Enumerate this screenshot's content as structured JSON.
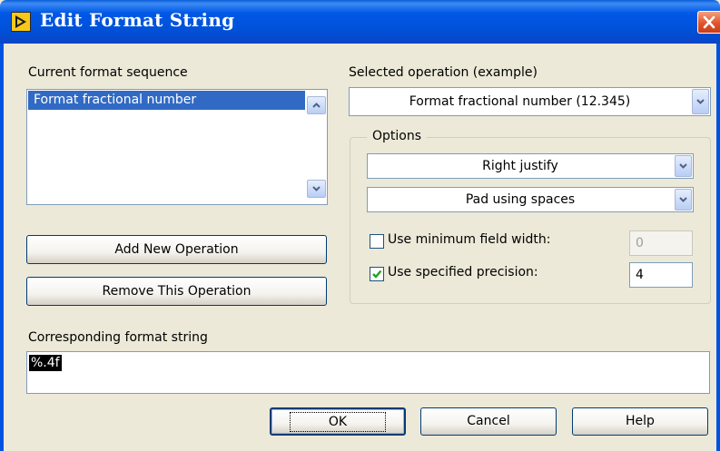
{
  "window": {
    "title": "Edit Format String"
  },
  "sequence": {
    "label": "Current format sequence",
    "items": [
      "Format fractional number"
    ],
    "add_button": "Add New Operation",
    "remove_button": "Remove This Operation"
  },
  "operation": {
    "label": "Selected operation (example)",
    "selected": "Format fractional number (12.345)"
  },
  "options": {
    "legend": "Options",
    "justify": "Right justify",
    "padding": "Pad using spaces",
    "min_width": {
      "label": "Use minimum field width:",
      "checked": false,
      "value": "0"
    },
    "precision": {
      "label": "Use specified precision:",
      "checked": true,
      "value": "4"
    }
  },
  "format_string": {
    "label": "Corresponding format string",
    "value": "%.4f"
  },
  "buttons": {
    "ok": "OK",
    "cancel": "Cancel",
    "help": "Help"
  },
  "colors": {
    "title_bar": "#0054e3",
    "dialog_bg": "#ece9d8",
    "selection": "#316ac5",
    "close_button": "#e2542b",
    "check": "#21a121"
  }
}
